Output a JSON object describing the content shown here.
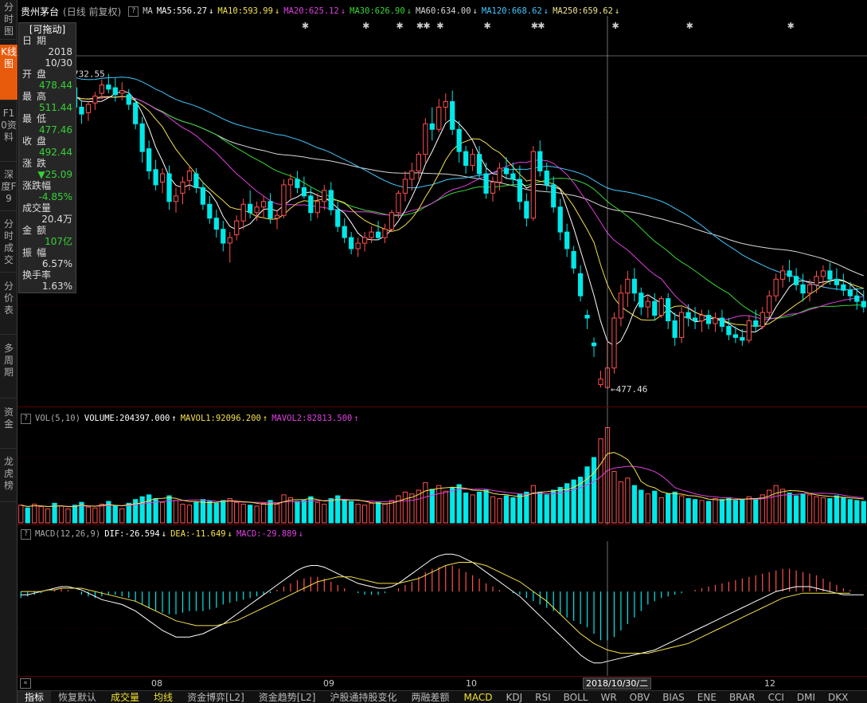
{
  "sidebar": {
    "tabs": [
      {
        "label": "分时图",
        "active": false
      },
      {
        "label": "K线图",
        "active": true
      },
      {
        "label": "F10资料",
        "active": false
      },
      {
        "label": "深度F9",
        "active": false
      },
      {
        "label": "分时成交",
        "active": false
      },
      {
        "label": "分价表",
        "active": false
      },
      {
        "label": "多周期",
        "active": false
      },
      {
        "label": "资金",
        "active": false
      },
      {
        "label": "龙虎榜",
        "active": false
      }
    ]
  },
  "main": {
    "stock": "贵州茅台",
    "period": "(日线 前复权)",
    "ma_label": "MA",
    "ma": [
      {
        "label": "MA5:556.27",
        "arrow": "↓",
        "color": "#ffffff"
      },
      {
        "label": "MA10:593.99",
        "arrow": "↓",
        "color": "#f5e14a"
      },
      {
        "label": "MA20:625.12",
        "arrow": "↓",
        "color": "#e040e0"
      },
      {
        "label": "MA30:626.90",
        "arrow": "↓",
        "color": "#38d838"
      },
      {
        "label": "MA60:634.00",
        "arrow": "↓",
        "color": "#d8d8d8"
      },
      {
        "label": "MA120:668.62",
        "arrow": "↓",
        "color": "#40c8ff"
      },
      {
        "label": "MA250:659.62",
        "arrow": "↓",
        "color": "#f0e68c"
      }
    ],
    "high_label": "732.55",
    "low_label": "477.46"
  },
  "info_panel": {
    "drag_label": "[可拖动]",
    "rows": [
      {
        "label": "日期",
        "value": "2018",
        "color": "white"
      },
      {
        "label": "",
        "value": "10/30",
        "color": "white"
      },
      {
        "label": "开盘",
        "value": "478.44",
        "color": "green"
      },
      {
        "label": "最高",
        "value": "511.44",
        "color": "green"
      },
      {
        "label": "最低",
        "value": "477.46",
        "color": "green"
      },
      {
        "label": "收盘",
        "value": "492.44",
        "color": "green"
      },
      {
        "label": "涨跌",
        "value": "▼25.09",
        "color": "green"
      },
      {
        "label": "涨跌幅",
        "value": "-4.85%",
        "color": "green"
      },
      {
        "label": "成交量",
        "value": "20.4万",
        "color": "white"
      },
      {
        "label": "金额",
        "value": "107亿",
        "color": "green"
      },
      {
        "label": "振幅",
        "value": "6.57%",
        "color": "white"
      },
      {
        "label": "换手率",
        "value": "1.63%",
        "color": "white"
      }
    ]
  },
  "vol_header": {
    "name": "VOL(5,10)",
    "volume": "VOLUME:204397.000",
    "mavol1": "MAVOL1:92096.200",
    "mavol2": "MAVOL2:82813.500",
    "arrow1": "↑",
    "arrow2": "↑",
    "arrow3": "↑"
  },
  "macd_header": {
    "name": "MACD(12,26,9)",
    "dif": "DIF:-26.594",
    "dea": "DEA:-11.649",
    "macd": "MACD:-29.889",
    "arrow1": "↓",
    "arrow2": "↓",
    "arrow3": "↓"
  },
  "x_axis": {
    "ticks": [
      "08",
      "09",
      "10",
      "12"
    ],
    "cursor_date": "2018/10/30/二"
  },
  "bottom_tabs": [
    "指标",
    "恢复默认",
    "成交量",
    "均线",
    "资金博弈[L2]",
    "资金趋势[L2]",
    "沪股通持股变化",
    "两融差额",
    "MACD",
    "KDJ",
    "RSI",
    "BOLL",
    "WR",
    "OBV",
    "BIAS",
    "ENE",
    "BRAR",
    "CCI",
    "DMI",
    "DKX"
  ],
  "colors": {
    "up": "#ff5050",
    "down": "#00e8e8",
    "ma5": "#ffffff",
    "ma10": "#f5e14a",
    "ma20": "#e040e0",
    "ma30": "#38d838",
    "ma60": "#d8d8d8",
    "ma120": "#40c8ff",
    "ma250": "#f0e68c",
    "grid": "#5a0000"
  },
  "chart_data": {
    "type": "candlestick",
    "title": "贵州茅台 (日线 前复权)",
    "ylim": [
      470,
      740
    ],
    "candles_ohlc": [
      [
        683,
        690,
        677,
        686
      ],
      [
        687,
        692,
        678,
        680
      ],
      [
        679,
        689,
        672,
        687
      ],
      [
        688,
        696,
        682,
        692
      ],
      [
        693,
        701,
        687,
        695
      ],
      [
        695,
        700,
        681,
        684
      ],
      [
        682,
        690,
        671,
        688
      ],
      [
        689,
        697,
        684,
        695
      ],
      [
        694,
        700,
        678,
        680
      ],
      [
        680,
        685,
        668,
        675
      ],
      [
        676,
        684,
        670,
        682
      ],
      [
        683,
        691,
        678,
        688
      ],
      [
        690,
        700,
        686,
        696
      ],
      [
        696,
        704,
        690,
        693
      ],
      [
        694,
        701,
        684,
        689
      ],
      [
        690,
        698,
        685,
        692
      ],
      [
        689,
        693,
        678,
        682
      ],
      [
        683,
        686,
        664,
        668
      ],
      [
        668,
        673,
        640,
        648
      ],
      [
        650,
        656,
        628,
        634
      ],
      [
        635,
        642,
        620,
        624
      ],
      [
        626,
        636,
        618,
        632
      ],
      [
        632,
        638,
        606,
        612
      ],
      [
        612,
        622,
        604,
        616
      ],
      [
        618,
        630,
        610,
        626
      ],
      [
        627,
        638,
        620,
        634
      ],
      [
        632,
        636,
        618,
        622
      ],
      [
        622,
        626,
        606,
        610
      ],
      [
        610,
        616,
        596,
        600
      ],
      [
        600,
        606,
        586,
        592
      ],
      [
        592,
        598,
        576,
        582
      ],
      [
        582,
        590,
        568,
        586
      ],
      [
        588,
        602,
        584,
        598
      ],
      [
        598,
        614,
        592,
        610
      ],
      [
        610,
        620,
        600,
        604
      ],
      [
        604,
        612,
        598,
        608
      ],
      [
        608,
        616,
        600,
        612
      ],
      [
        612,
        618,
        596,
        600
      ],
      [
        600,
        606,
        592,
        602
      ],
      [
        602,
        628,
        600,
        624
      ],
      [
        624,
        632,
        614,
        628
      ],
      [
        628,
        634,
        618,
        622
      ],
      [
        622,
        630,
        614,
        616
      ],
      [
        616,
        622,
        598,
        604
      ],
      [
        604,
        618,
        600,
        612
      ],
      [
        612,
        624,
        606,
        620
      ],
      [
        620,
        626,
        602,
        606
      ],
      [
        606,
        612,
        590,
        594
      ],
      [
        594,
        600,
        582,
        586
      ],
      [
        586,
        590,
        574,
        578
      ],
      [
        578,
        586,
        572,
        582
      ],
      [
        582,
        590,
        576,
        586
      ],
      [
        586,
        594,
        582,
        590
      ],
      [
        590,
        598,
        584,
        586
      ],
      [
        586,
        596,
        582,
        592
      ],
      [
        592,
        606,
        590,
        604
      ],
      [
        604,
        620,
        600,
        618
      ],
      [
        618,
        634,
        612,
        628
      ],
      [
        628,
        640,
        620,
        634
      ],
      [
        634,
        648,
        628,
        646
      ],
      [
        646,
        672,
        640,
        668
      ],
      [
        668,
        680,
        656,
        664
      ],
      [
        664,
        686,
        662,
        680
      ],
      [
        680,
        690,
        670,
        684
      ],
      [
        684,
        692,
        660,
        664
      ],
      [
        664,
        670,
        640,
        648
      ],
      [
        648,
        652,
        632,
        638
      ],
      [
        638,
        650,
        634,
        646
      ],
      [
        646,
        652,
        628,
        632
      ],
      [
        632,
        640,
        614,
        618
      ],
      [
        618,
        630,
        612,
        626
      ],
      [
        626,
        640,
        620,
        636
      ],
      [
        636,
        644,
        628,
        632
      ],
      [
        632,
        640,
        624,
        628
      ],
      [
        628,
        638,
        606,
        612
      ],
      [
        612,
        618,
        594,
        600
      ],
      [
        600,
        652,
        598,
        648
      ],
      [
        648,
        656,
        630,
        634
      ],
      [
        634,
        640,
        620,
        624
      ],
      [
        624,
        630,
        604,
        608
      ],
      [
        608,
        614,
        584,
        590
      ],
      [
        590,
        596,
        572,
        578
      ],
      [
        576,
        580,
        560,
        564
      ],
      [
        560,
        566,
        540,
        544
      ],
      [
        530,
        534,
        520,
        528
      ],
      [
        510,
        514,
        500,
        508
      ],
      [
        480,
        490,
        478,
        484
      ],
      [
        478,
        512,
        477,
        492
      ],
      [
        492,
        532,
        488,
        528
      ],
      [
        528,
        552,
        522,
        546
      ],
      [
        546,
        562,
        536,
        556
      ],
      [
        556,
        564,
        540,
        546
      ],
      [
        546,
        550,
        530,
        536
      ],
      [
        536,
        544,
        528,
        540
      ],
      [
        540,
        546,
        526,
        530
      ],
      [
        530,
        544,
        528,
        542
      ],
      [
        542,
        546,
        520,
        526
      ],
      [
        526,
        532,
        508,
        514
      ],
      [
        514,
        536,
        510,
        532
      ],
      [
        532,
        538,
        522,
        528
      ],
      [
        528,
        536,
        520,
        526
      ],
      [
        526,
        534,
        518,
        530
      ],
      [
        530,
        534,
        520,
        524
      ],
      [
        524,
        532,
        518,
        528
      ],
      [
        528,
        534,
        518,
        522
      ],
      [
        522,
        528,
        512,
        516
      ],
      [
        516,
        522,
        510,
        514
      ],
      [
        514,
        520,
        508,
        512
      ],
      [
        512,
        530,
        510,
        526
      ],
      [
        526,
        534,
        518,
        522
      ],
      [
        522,
        536,
        520,
        532
      ],
      [
        532,
        548,
        528,
        544
      ],
      [
        544,
        560,
        540,
        556
      ],
      [
        556,
        566,
        550,
        562
      ],
      [
        562,
        570,
        554,
        558
      ],
      [
        558,
        564,
        548,
        552
      ],
      [
        552,
        560,
        540,
        546
      ],
      [
        546,
        556,
        540,
        552
      ],
      [
        552,
        562,
        546,
        558
      ],
      [
        558,
        566,
        550,
        562
      ],
      [
        562,
        568,
        552,
        556
      ],
      [
        556,
        564,
        548,
        552
      ],
      [
        552,
        560,
        544,
        548
      ],
      [
        548,
        554,
        540,
        544
      ],
      [
        544,
        550,
        534,
        540
      ],
      [
        540,
        548,
        532,
        536
      ]
    ],
    "volume": [
      38,
      32,
      40,
      35,
      30,
      42,
      36,
      30,
      38,
      44,
      34,
      32,
      40,
      46,
      36,
      30,
      42,
      50,
      56,
      60,
      52,
      44,
      58,
      48,
      40,
      38,
      44,
      50,
      46,
      42,
      48,
      52,
      44,
      40,
      38,
      36,
      42,
      48,
      40,
      60,
      54,
      46,
      48,
      56,
      44,
      40,
      52,
      58,
      50,
      46,
      40,
      38,
      42,
      44,
      40,
      48,
      58,
      66,
      62,
      70,
      86,
      72,
      80,
      68,
      76,
      82,
      64,
      60,
      66,
      70,
      56,
      52,
      58,
      54,
      62,
      66,
      80,
      66,
      60,
      70,
      76,
      84,
      92,
      98,
      120,
      140,
      180,
      204,
      110,
      88,
      96,
      80,
      70,
      62,
      68,
      54,
      62,
      66,
      58,
      52,
      50,
      48,
      46,
      52,
      50,
      54,
      48,
      50,
      56,
      52,
      60,
      70,
      80,
      72,
      64,
      58,
      62,
      60,
      56,
      54,
      52,
      58,
      54,
      50,
      48,
      46
    ],
    "vol_ylim": [
      0,
      210
    ],
    "macd": [
      -4,
      -3,
      -2,
      -1,
      0,
      1,
      2,
      1,
      0,
      -2,
      -3,
      -4,
      -3,
      -2,
      -2,
      -3,
      -4,
      -6,
      -8,
      -10,
      -12,
      -13,
      -14,
      -14,
      -13,
      -12,
      -12,
      -12,
      -11,
      -10,
      -8,
      -7,
      -6,
      -5,
      -4,
      -3,
      -2,
      -1,
      1,
      3,
      5,
      7,
      8,
      9,
      9,
      8,
      6,
      4,
      2,
      0,
      -1,
      -2,
      -2,
      -2,
      -1,
      0,
      2,
      4,
      6,
      9,
      12,
      14,
      15,
      16,
      16,
      14,
      12,
      10,
      8,
      5,
      3,
      1,
      0,
      -1,
      -2,
      -4,
      -6,
      -8,
      -10,
      -12,
      -14,
      -16,
      -18,
      -20,
      -22,
      -26,
      -30,
      -30,
      -28,
      -24,
      -20,
      -16,
      -12,
      -8,
      -6,
      -4,
      -3,
      -2,
      -1,
      0,
      1,
      2,
      3,
      4,
      5,
      6,
      7,
      8,
      9,
      10,
      11,
      12,
      13,
      14,
      14,
      13,
      12,
      11,
      10,
      8,
      6,
      4,
      2,
      1
    ],
    "dif": [
      -2,
      -2,
      -1,
      0,
      1,
      2,
      3,
      3,
      2,
      1,
      -1,
      -3,
      -5,
      -6,
      -7,
      -8,
      -10,
      -12,
      -15,
      -18,
      -21,
      -24,
      -26,
      -28,
      -28,
      -28,
      -27,
      -26,
      -24,
      -22,
      -20,
      -17,
      -14,
      -11,
      -8,
      -5,
      -2,
      1,
      4,
      7,
      10,
      13,
      15,
      16,
      16,
      15,
      13,
      11,
      9,
      7,
      5,
      4,
      3,
      2,
      2,
      3,
      5,
      8,
      11,
      14,
      17,
      20,
      22,
      23,
      23,
      22,
      20,
      18,
      15,
      12,
      9,
      6,
      3,
      0,
      -3,
      -7,
      -11,
      -15,
      -19,
      -23,
      -27,
      -31,
      -35,
      -39,
      -42,
      -44,
      -44,
      -43,
      -42,
      -41,
      -40,
      -39,
      -38,
      -37,
      -36,
      -34,
      -32,
      -30,
      -28,
      -26,
      -24,
      -22,
      -20,
      -18,
      -16,
      -14,
      -12,
      -10,
      -8,
      -6,
      -4,
      -2,
      0,
      1,
      2,
      3,
      3,
      3,
      2,
      1,
      0,
      -1,
      -2,
      -2,
      -2,
      -2
    ],
    "dea": [
      0,
      0,
      0,
      0,
      1,
      1,
      2,
      2,
      2,
      2,
      1,
      0,
      -1,
      -2,
      -3,
      -4,
      -5,
      -6,
      -8,
      -10,
      -12,
      -14,
      -16,
      -18,
      -19,
      -20,
      -21,
      -21,
      -21,
      -21,
      -20,
      -19,
      -18,
      -16,
      -14,
      -12,
      -10,
      -8,
      -6,
      -4,
      -2,
      0,
      2,
      4,
      6,
      7,
      8,
      9,
      9,
      9,
      8,
      7,
      6,
      5,
      5,
      5,
      5,
      6,
      7,
      8,
      10,
      12,
      14,
      16,
      17,
      18,
      18,
      18,
      17,
      16,
      14,
      12,
      10,
      8,
      6,
      3,
      0,
      -3,
      -6,
      -10,
      -14,
      -18,
      -22,
      -26,
      -29,
      -32,
      -34,
      -36,
      -37,
      -38,
      -38,
      -38,
      -38,
      -38,
      -37,
      -36,
      -35,
      -34,
      -33,
      -32,
      -30,
      -28,
      -26,
      -24,
      -22,
      -20,
      -18,
      -16,
      -14,
      -12,
      -10,
      -8,
      -6,
      -4,
      -3,
      -2,
      -1,
      -1,
      -1,
      -1,
      -1,
      -1,
      -1,
      -1
    ],
    "macd_ylim": [
      -50,
      30
    ]
  }
}
